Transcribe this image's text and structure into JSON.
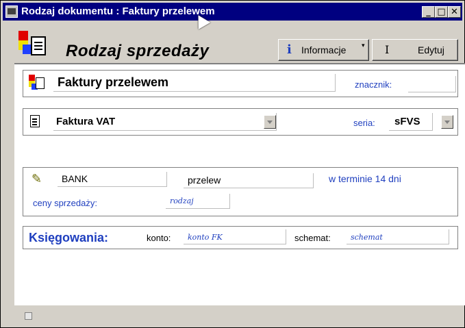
{
  "window": {
    "title": "Rodzaj dokumentu : Faktury przelewem",
    "minimize_glyph": "_",
    "maximize_glyph": "□",
    "close_glyph": "✕"
  },
  "toolbar": {
    "page_title": "Rodzaj sprzedaży",
    "info_label": "Informacje",
    "info_caret": "▾",
    "edit_label": "Edytuj",
    "edit_icon_glyph": "I"
  },
  "document_type": {
    "name": "Faktury przelewem",
    "tag_label": "znacznik:",
    "tag_value": ""
  },
  "invoice": {
    "type": "Faktura VAT",
    "series_label": "seria:",
    "series_value": "sFVS"
  },
  "payment": {
    "bank": "BANK",
    "method": "przelew",
    "term": "w terminie 14 dni",
    "prices_label": "ceny sprzedaży:",
    "prices_value": "rodzaj"
  },
  "accounting": {
    "title": "Księgowania:",
    "account_label": "konto:",
    "account_value": "konto FK",
    "scheme_label": "schemat:",
    "scheme_value": "schemat"
  },
  "colors": {
    "title_bar": "#000080",
    "accent_blue": "#1f3fbf",
    "window_bg": "#d4d0c8"
  }
}
